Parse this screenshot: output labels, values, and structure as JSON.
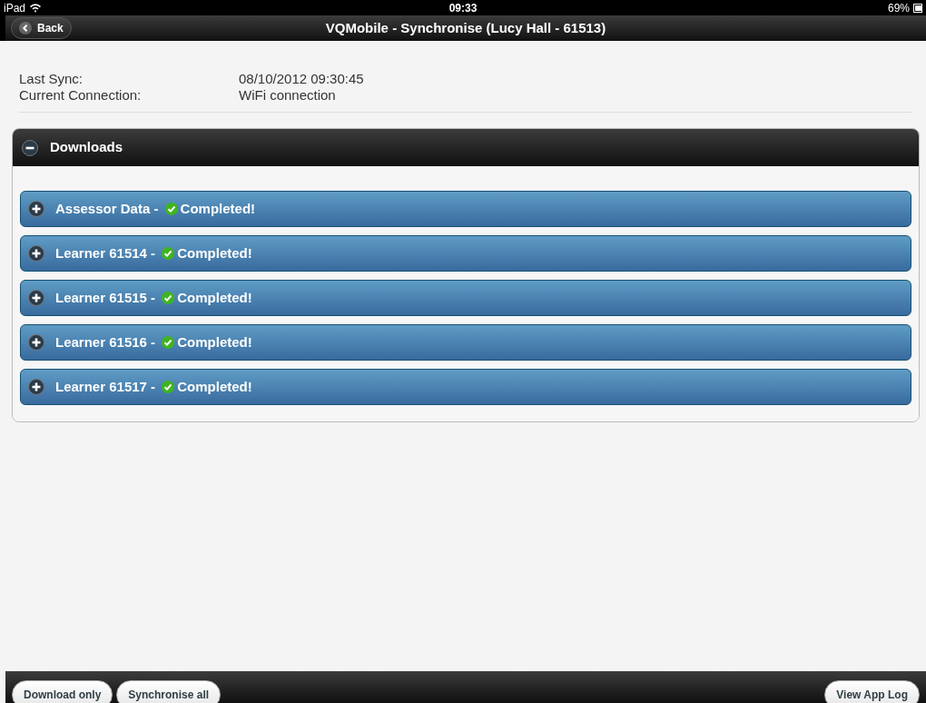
{
  "status_bar": {
    "device": "iPad",
    "time": "09:33",
    "battery": "69%"
  },
  "header": {
    "back": "Back",
    "title": "VQMobile - Synchronise (Lucy Hall - 61513)"
  },
  "info": [
    {
      "label": "Last Sync:",
      "value": "08/10/2012 09:30:45"
    },
    {
      "label": "Current Connection:",
      "value": "WiFi connection"
    }
  ],
  "section": {
    "title": "Downloads",
    "expanded": true,
    "items": [
      {
        "label": "Assessor Data - ",
        "status": "Completed!",
        "expanded": false
      },
      {
        "label": "Learner 61514 - ",
        "status": "Completed!",
        "expanded": false
      },
      {
        "label": "Learner 61515 - ",
        "status": "Completed!",
        "expanded": false
      },
      {
        "label": "Learner 61516 - ",
        "status": "Completed!",
        "expanded": false
      },
      {
        "label": "Learner 61517 - ",
        "status": "Completed!",
        "expanded": false
      }
    ]
  },
  "footer": {
    "left_buttons": [
      "Download only",
      "Synchronise all"
    ],
    "right_buttons": [
      "View App Log"
    ]
  }
}
